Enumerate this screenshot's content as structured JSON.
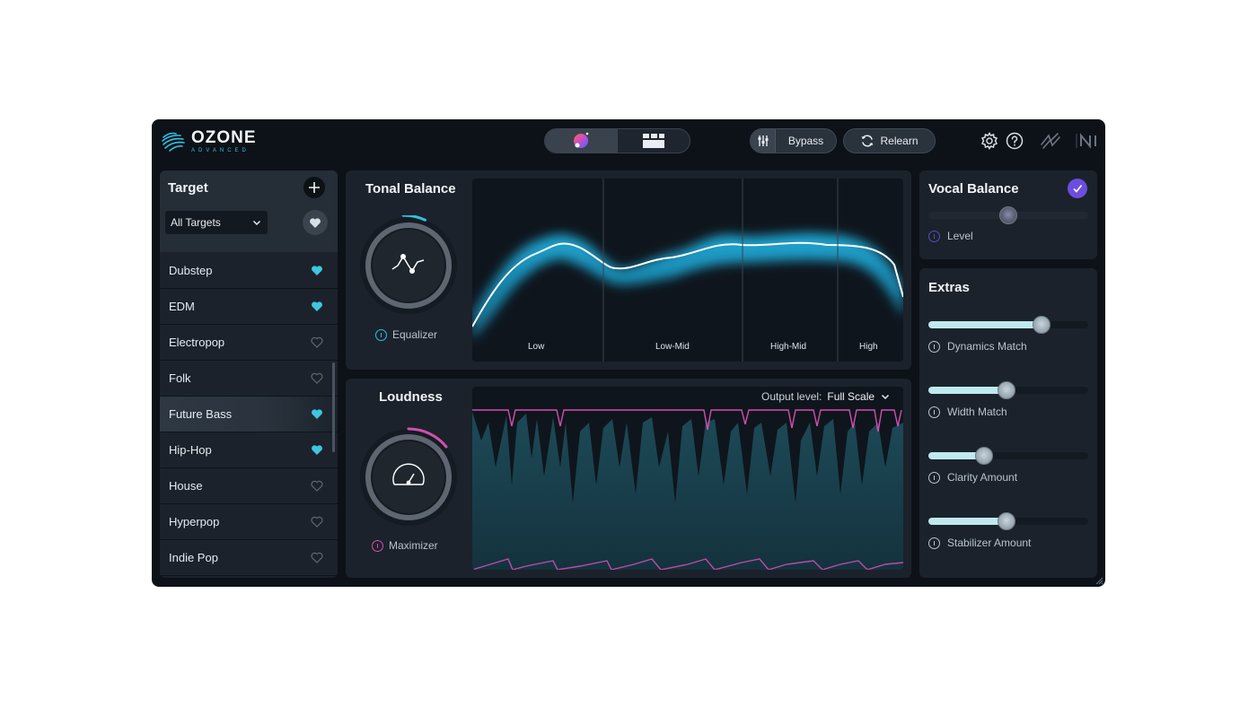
{
  "header": {
    "logo_title": "OZONE",
    "logo_sub": "ADVANCED",
    "bypass_label": "Bypass",
    "relearn_label": "Relearn"
  },
  "target": {
    "title": "Target",
    "filter": "All Targets",
    "items": [
      {
        "label": "Dubstep",
        "favorite": true
      },
      {
        "label": "EDM",
        "favorite": true
      },
      {
        "label": "Electropop",
        "favorite": false
      },
      {
        "label": "Folk",
        "favorite": false
      },
      {
        "label": "Future Bass",
        "favorite": true,
        "selected": true
      },
      {
        "label": "Hip-Hop",
        "favorite": true
      },
      {
        "label": "House",
        "favorite": false
      },
      {
        "label": "Hyperpop",
        "favorite": false
      },
      {
        "label": "Indie Pop",
        "favorite": false
      }
    ]
  },
  "tonal": {
    "title": "Tonal Balance",
    "module": "Equalizer",
    "bands": [
      "Low",
      "Low-Mid",
      "High-Mid",
      "High"
    ]
  },
  "loudness": {
    "title": "Loudness",
    "module": "Maximizer",
    "output_label": "Output level:",
    "output_value": "Full Scale"
  },
  "vocal": {
    "title": "Vocal Balance",
    "level_label": "Level",
    "level": 0.5
  },
  "extras": {
    "title": "Extras",
    "sliders": [
      {
        "label": "Dynamics Match",
        "value": 0.71
      },
      {
        "label": "Width Match",
        "value": 0.49
      },
      {
        "label": "Clarity Amount",
        "value": 0.35
      },
      {
        "label": "Stabilizer Amount",
        "value": 0.49
      }
    ]
  },
  "colors": {
    "accent_cyan": "#2fc1e4",
    "accent_pink": "#d24fb0",
    "accent_purple": "#6b4ee0",
    "favorite": "#3ec6e0"
  }
}
